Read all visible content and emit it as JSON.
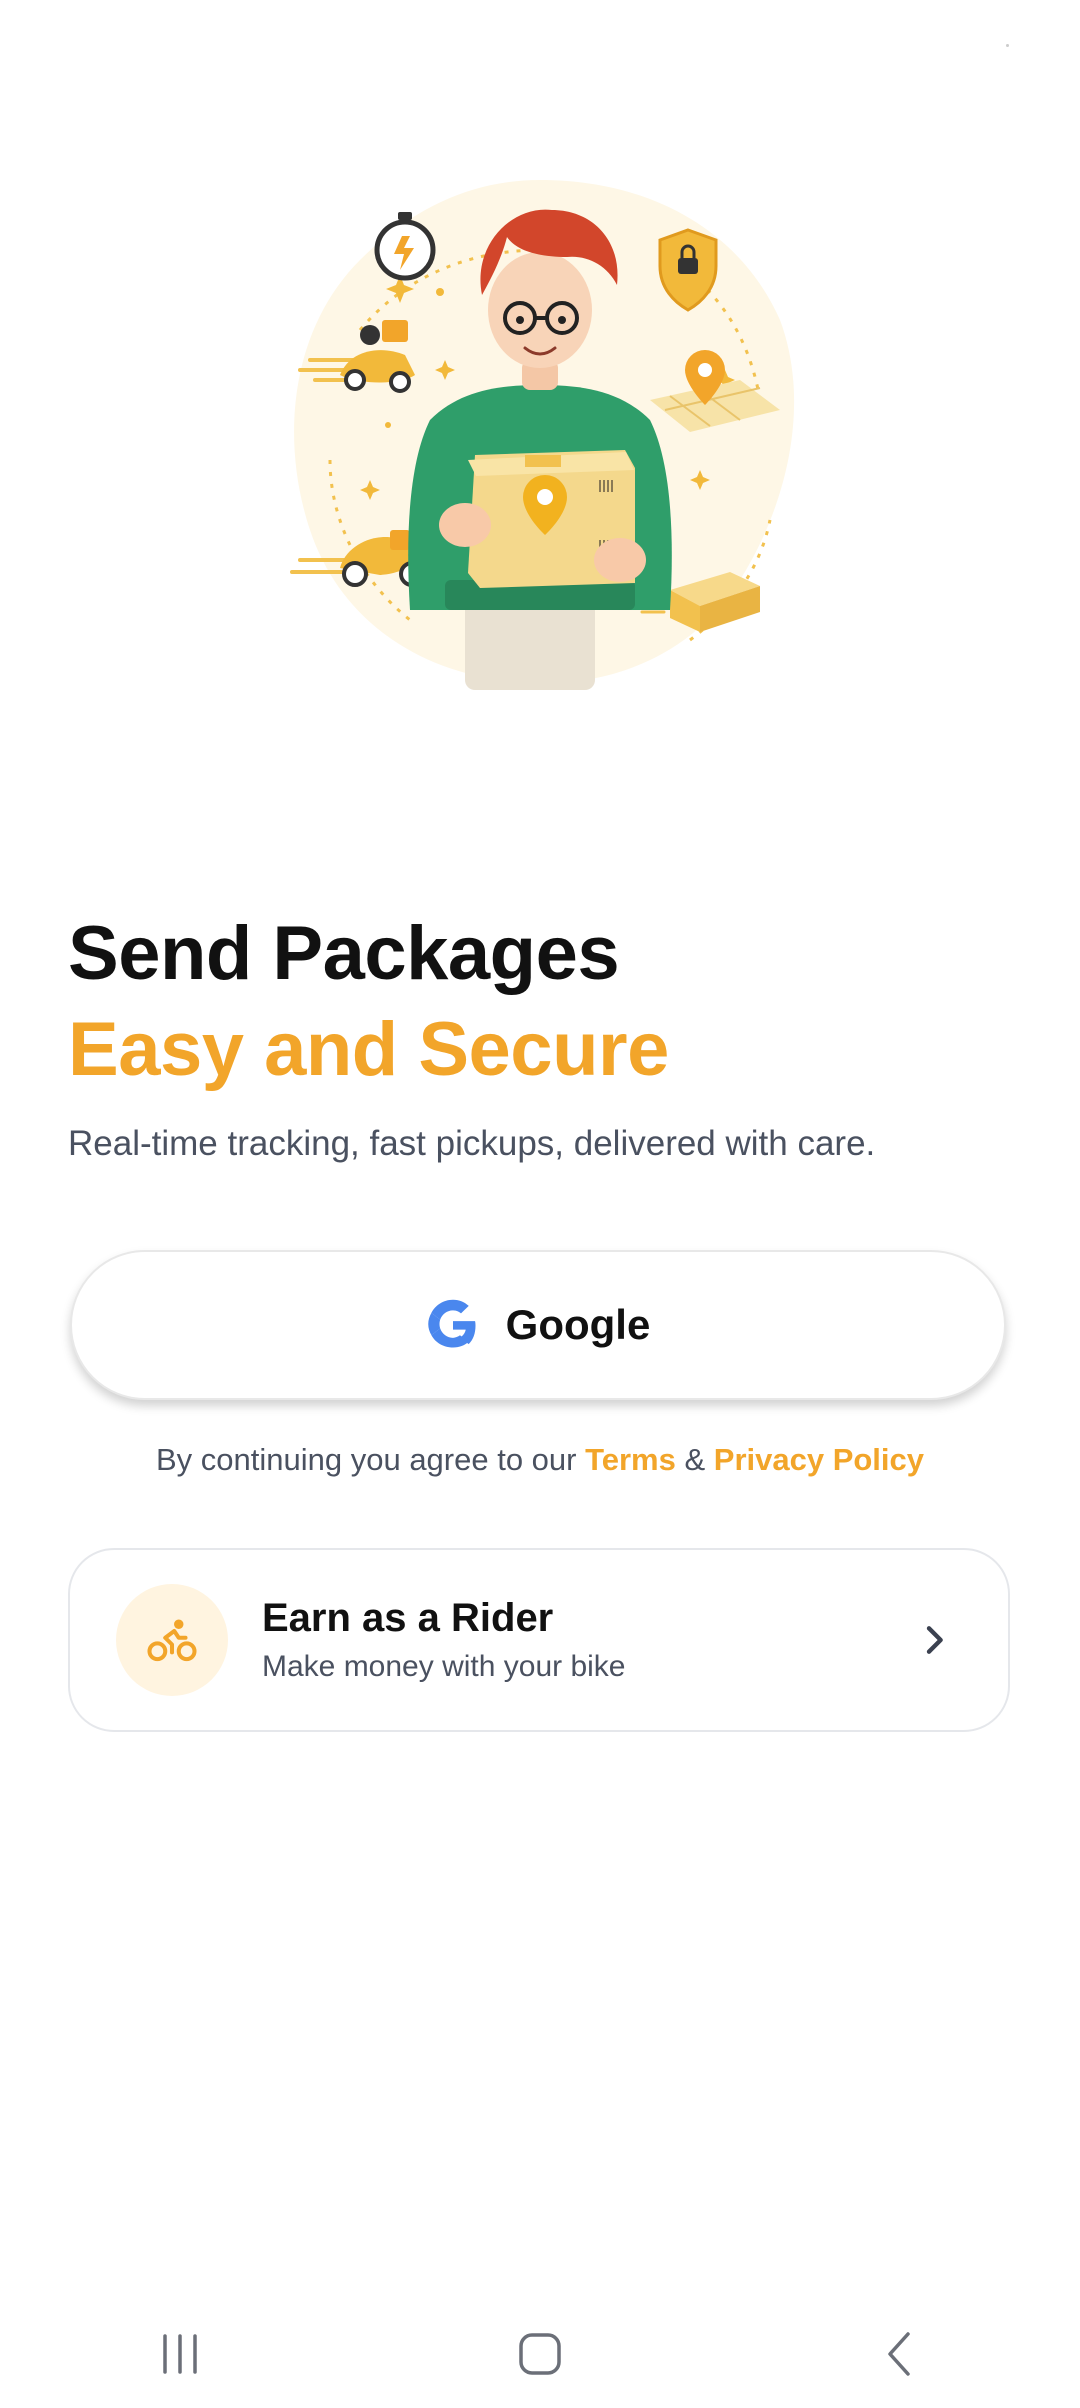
{
  "theme": {
    "accent": "#F2A52A",
    "text_primary": "#111111",
    "text_secondary": "#4A5160",
    "google_blue": "#4A87EE"
  },
  "hero": {
    "alt": "Person holding a package surrounded by delivery icons",
    "icons": [
      "stopwatch-icon",
      "scooter-icon",
      "shield-lock-icon",
      "map-pin-icon",
      "package-icon"
    ]
  },
  "headline": {
    "line1": "Send Packages",
    "line2": "Easy and Secure",
    "subtitle": "Real-time tracking, fast pickups, delivered with care."
  },
  "google_button": {
    "label": "Google",
    "icon": "google-icon"
  },
  "legal": {
    "prefix": "By continuing you agree to our ",
    "terms": "Terms",
    "amp": " & ",
    "privacy": "Privacy Policy"
  },
  "rider_card": {
    "title": "Earn as a Rider",
    "subtitle": "Make money with your bike",
    "icon": "bicycle-icon",
    "chevron": "chevron-right-icon"
  },
  "nav": {
    "recents": "recents-icon",
    "home": "home-icon",
    "back": "back-icon"
  }
}
